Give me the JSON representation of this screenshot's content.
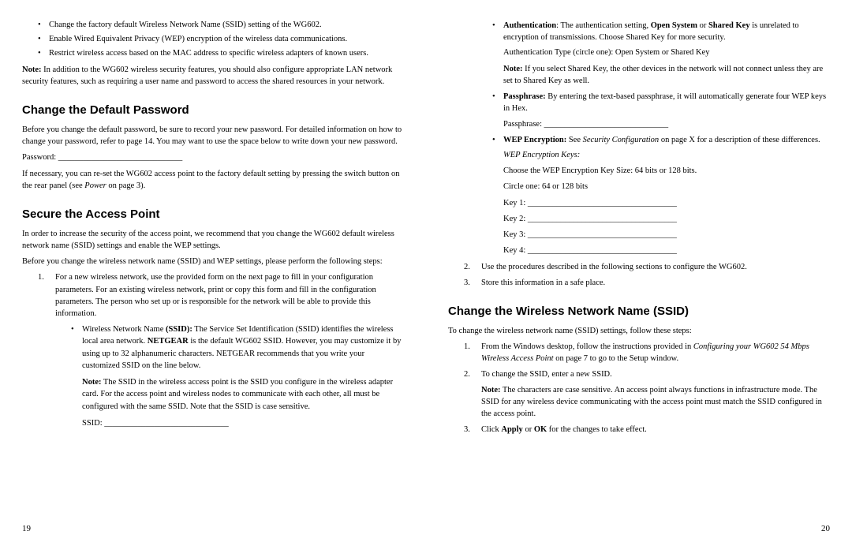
{
  "left": {
    "top_bullets": [
      "Change the factory default Wireless Network Name (SSID) setting of the WG602.",
      "Enable Wired Equivalent Privacy (WEP) encryption of the wireless data communications.",
      "Restrict wireless access based on the MAC address to specific wireless adapters of known users."
    ],
    "top_note_bold": "Note:",
    "top_note": " In addition to the WG602 wireless security features, you should also configure appropriate LAN network security features, such as requiring a user name and password to access the shared resources in your network.",
    "h_password": "Change the Default Password",
    "p_password": "Before you change the default password, be sure to record your new password. For detailed information on how to change your password, refer to page 14. You may want to use the space below to write down your new password.",
    "password_label": "Password: ______________________________",
    "p_reset_a": "If necessary, you can re-set the WG602 access point to the factory default setting by pressing the switch button on the rear panel (see ",
    "p_reset_i": "Power",
    "p_reset_b": " on page 3).",
    "h_secure": "Secure the Access Point",
    "p_secure1": "In order to increase the security of the access point, we recommend that you change the WG602 default wireless network name (SSID) settings and enable the WEP settings.",
    "p_secure2": "Before you change the wireless network name (SSID) and WEP settings, please perform the following steps:",
    "step1_num": "1.",
    "step1": "For a new wireless network, use the provided form on the next page to fill in your configuration parameters. For an existing wireless network, print or copy this form and fill in the configuration parameters. The person who set up or is responsible for the network will be able to provide this information.",
    "sub1_a": "Wireless Network Name ",
    "sub1_b": "(SSID):",
    "sub1_c": " The Service Set Identification (SSID) identifies the wireless local area network. ",
    "sub1_d": "NETGEAR",
    "sub1_e": " is the default WG602 SSID. However, you may customize it by using up to 32 alphanumeric characters. NETGEAR recommends that you write your customized SSID on the line below.",
    "sub1_note_bold": "Note:",
    "sub1_note": " The SSID in the wireless access point is the SSID you configure in the wireless adapter card. For the access point and wireless nodes to communicate with each other, all must be configured with the same SSID. Note that the SSID is case sensitive.",
    "ssid_label": "SSID: ______________________________",
    "pagenum": "19"
  },
  "right": {
    "auth_a": "Authentication",
    "auth_b": ": The authentication setting, ",
    "auth_c": "Open System",
    "auth_d": " or ",
    "auth_e": "Shared Key",
    "auth_f": " is unrelated to encryption of transmissions. Choose Shared Key for more security.",
    "auth_line": "Authentication Type (circle one): Open System or Shared Key",
    "auth_note_bold": "Note:",
    "auth_note": " If you select Shared Key, the other devices in the network will not connect unless they are set to Shared Key as well.",
    "pass_a": "Passphrase:",
    "pass_b": " By entering the text-based passphrase, it will automatically generate four WEP keys in Hex.",
    "pass_line": "Passphrase: ______________________________",
    "wep_a": "WEP Encryption:",
    "wep_b": " See ",
    "wep_i": "Security Configuration",
    "wep_c": " on page X for a description of these differences.",
    "wep_keys_i": "WEP Encryption Keys:",
    "wep_size": "Choose the WEP Encryption Key Size: 64 bits or 128 bits.",
    "circle": "Circle one: 64 or 128 bits",
    "key1": "Key 1: ____________________________________",
    "key2": "Key 2: ____________________________________",
    "key3": "Key 3: ____________________________________",
    "key4": "Key 4: ____________________________________",
    "step2_num": "2.",
    "step2": "Use the procedures described in the following sections to configure the WG602.",
    "step3_num": "3.",
    "step3": "Store this information in a safe place.",
    "h_ssid": "Change the Wireless Network Name (SSID)",
    "p_ssid": "To change the wireless network name (SSID) settings, follow these steps:",
    "s1_num": "1.",
    "s1_a": "From the Windows desktop, follow the instructions provided in ",
    "s1_i": "Configuring your WG602 54 Mbps Wireless Access Point",
    "s1_b": " on page 7 to go to the Setup window.",
    "s2_num": "2.",
    "s2": "To change the SSID, enter a new SSID.",
    "s2_note_bold": "Note:",
    "s2_note": " The characters are case sensitive. An access point always functions in infrastructure mode. The SSID for any wireless device communicating with the access point must match the SSID configured in the access point.",
    "s3_num": "3.",
    "s3_a": "Click ",
    "s3_b": "Apply",
    "s3_c": " or ",
    "s3_d": "OK",
    "s3_e": " for the changes to take effect.",
    "pagenum": "20"
  }
}
